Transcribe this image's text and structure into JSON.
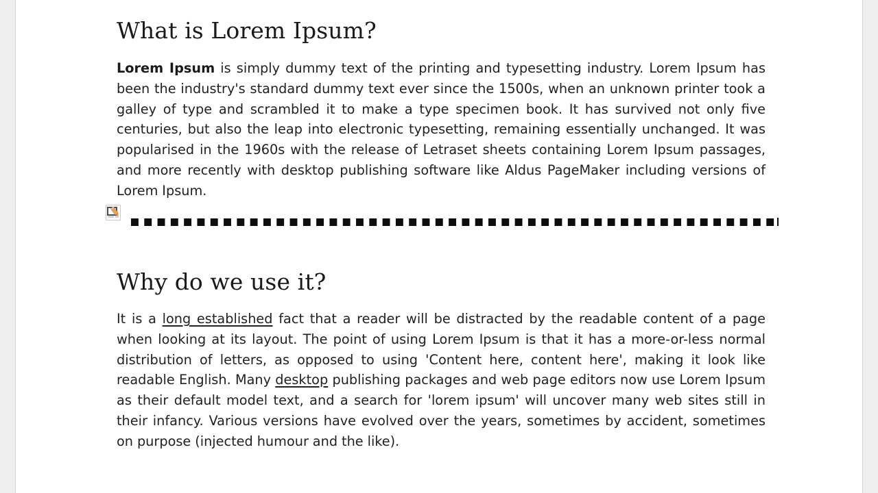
{
  "document": {
    "background_color": "#efefef",
    "page_color": "#ffffff",
    "page_border_color": "#d7d8da",
    "text_color": "#222222",
    "heading_color": "#1a1a1a"
  },
  "sections": [
    {
      "heading": "What is Lorem Ipsum?",
      "paragraph": {
        "lead_bold": "Lorem Ipsum",
        "body": " is simply dummy text of the printing and typesetting industry. Lorem Ipsum has been the industry's standard dummy text ever since the 1500s, when an unknown printer took a galley of type and scrambled it to make a type specimen book. It has survived not only five centuries, but also the leap into electronic typesetting, remaining essentially unchanged. It was popularised in the 1960s with the release of Letraset sheets containing Lorem Ipsum passages, and more recently with desktop publishing software like Aldus PageMaker including versions of Lorem Ipsum."
      }
    },
    {
      "heading": "Why do we use it?",
      "paragraph": {
        "part_1": "It is a ",
        "link_1": "long established",
        "part_2": " fact that a reader will be distracted by the readable content of a page when looking at its layout. The point of using Lorem Ipsum is that it has a more-or-less normal distribution of letters, as opposed to using 'Content here, content here', making it look like readable English. Many ",
        "link_2": "desktop",
        "part_3": " publishing packages and web page editors now use Lorem Ipsum as their default model text, and a search for 'lorem ipsum' will uncover many web sites still in their infancy. Various versions have evolved over the years, sometimes by accident, sometimes on purpose (injected humour and the like)."
      }
    }
  ],
  "separator": {
    "name": "page-break-dotted-rule",
    "dot_color": "#0d0d0d",
    "caret_color": "#0d0d0d"
  },
  "gutter_marker": {
    "name": "section-break-marker-icon",
    "frame_color": "#4a4a4a",
    "pencil_color": "#e8a25c",
    "pencil_tip_color": "#d98c3a"
  }
}
